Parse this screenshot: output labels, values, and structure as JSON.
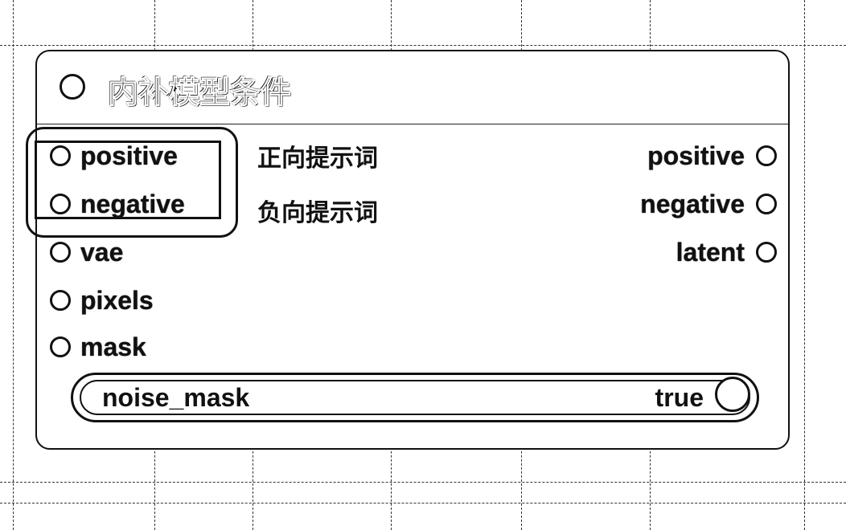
{
  "node": {
    "title": "内补模型条件",
    "inputs": [
      {
        "label": "positive"
      },
      {
        "label": "negative"
      },
      {
        "label": "vae"
      },
      {
        "label": "pixels"
      },
      {
        "label": "mask"
      }
    ],
    "input_translations": [
      "正向提示词",
      "负向提示词"
    ],
    "outputs": [
      {
        "label": "positive"
      },
      {
        "label": "negative"
      },
      {
        "label": "latent"
      }
    ],
    "widget": {
      "name": "noise_mask",
      "value": "true"
    }
  }
}
